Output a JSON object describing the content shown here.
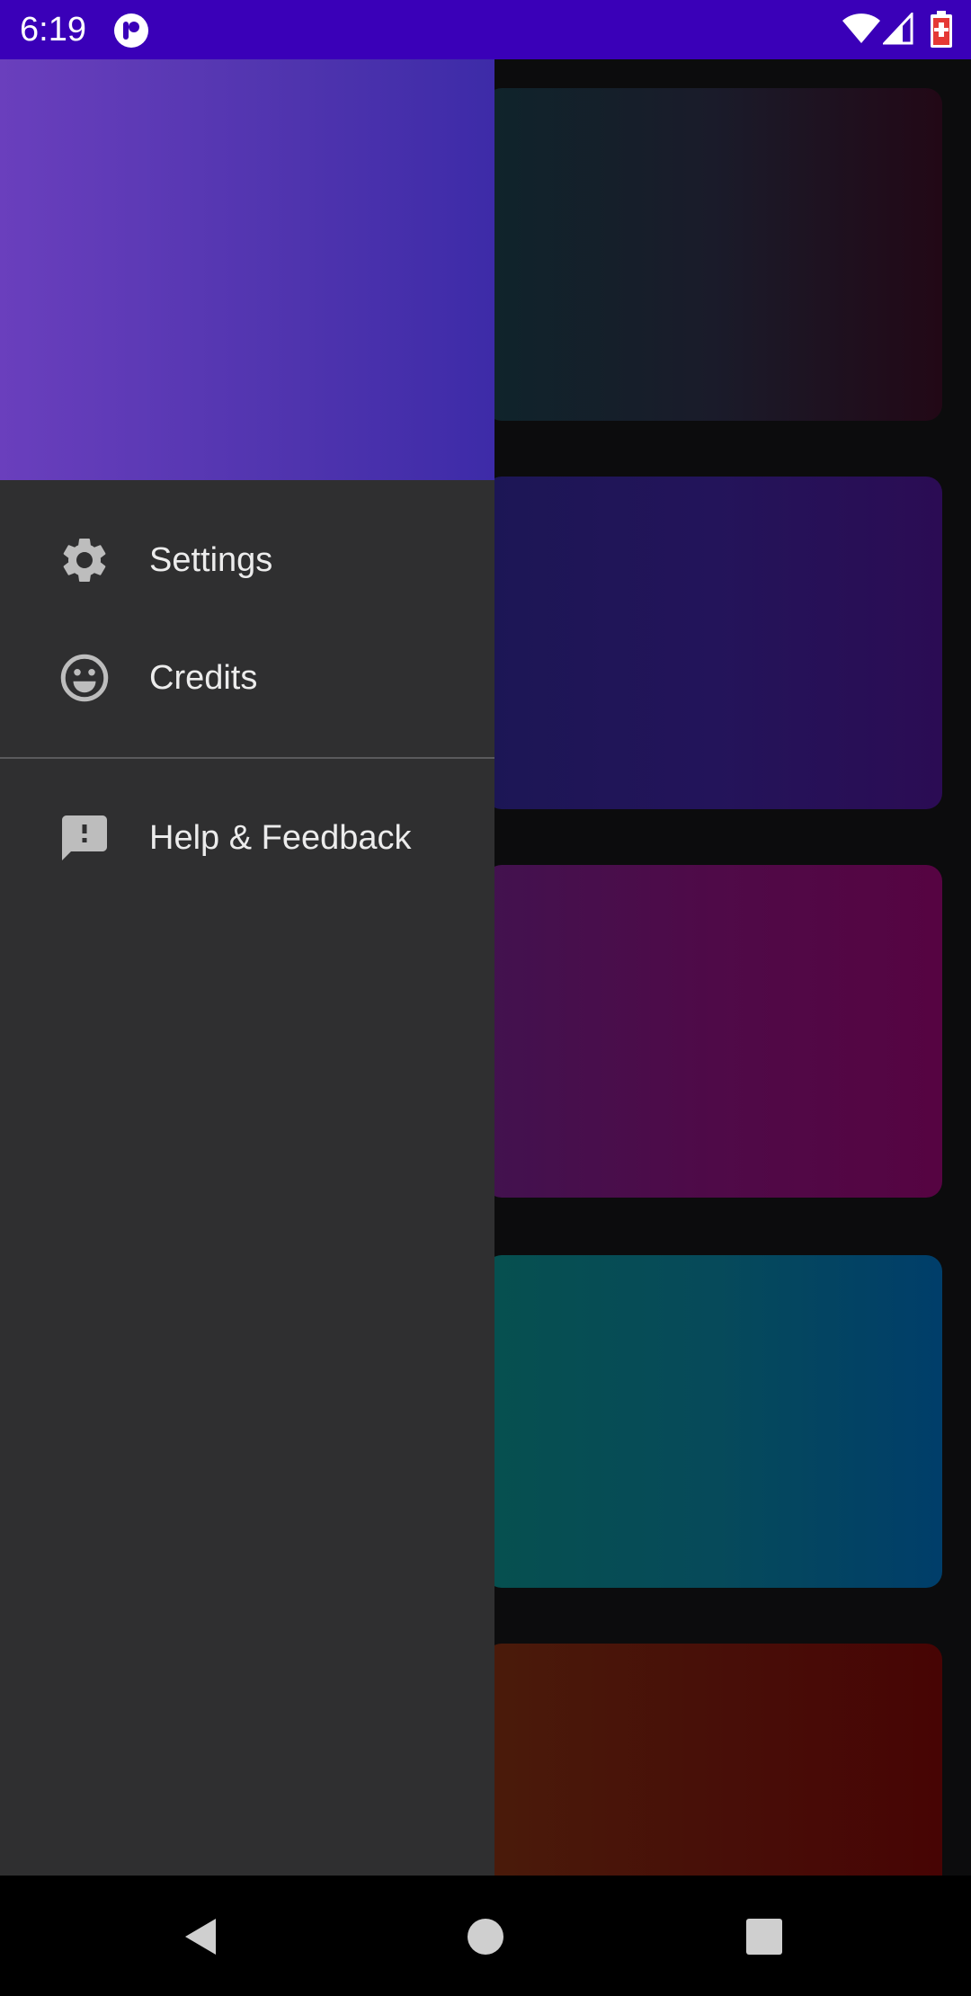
{
  "status_bar": {
    "time": "6:19",
    "background_color": "#3a00b8",
    "icons": [
      "app-notification-icon",
      "wifi-icon",
      "signal-icon",
      "battery-charging-icon"
    ]
  },
  "drawer": {
    "header_gradient": [
      "#6a3fbd",
      "#3d2ba8"
    ],
    "items": [
      {
        "label": "Settings",
        "icon": "gear-icon"
      },
      {
        "label": "Credits",
        "icon": "smiley-icon"
      },
      {
        "label": "Help & Feedback",
        "icon": "feedback-icon"
      }
    ]
  },
  "background_cards": [
    {
      "colors": [
        "#0f242b",
        "#220816"
      ]
    },
    {
      "colors": [
        "#1c1655",
        "#2b0c54"
      ]
    },
    {
      "colors": [
        "#42124f",
        "#560442"
      ]
    },
    {
      "colors": [
        "#06504f",
        "#003e6a"
      ]
    },
    {
      "colors": [
        "#4a1b0a",
        "#470404"
      ]
    }
  ],
  "nav_bar": {
    "buttons": [
      "back-icon",
      "home-icon",
      "recents-icon"
    ]
  }
}
